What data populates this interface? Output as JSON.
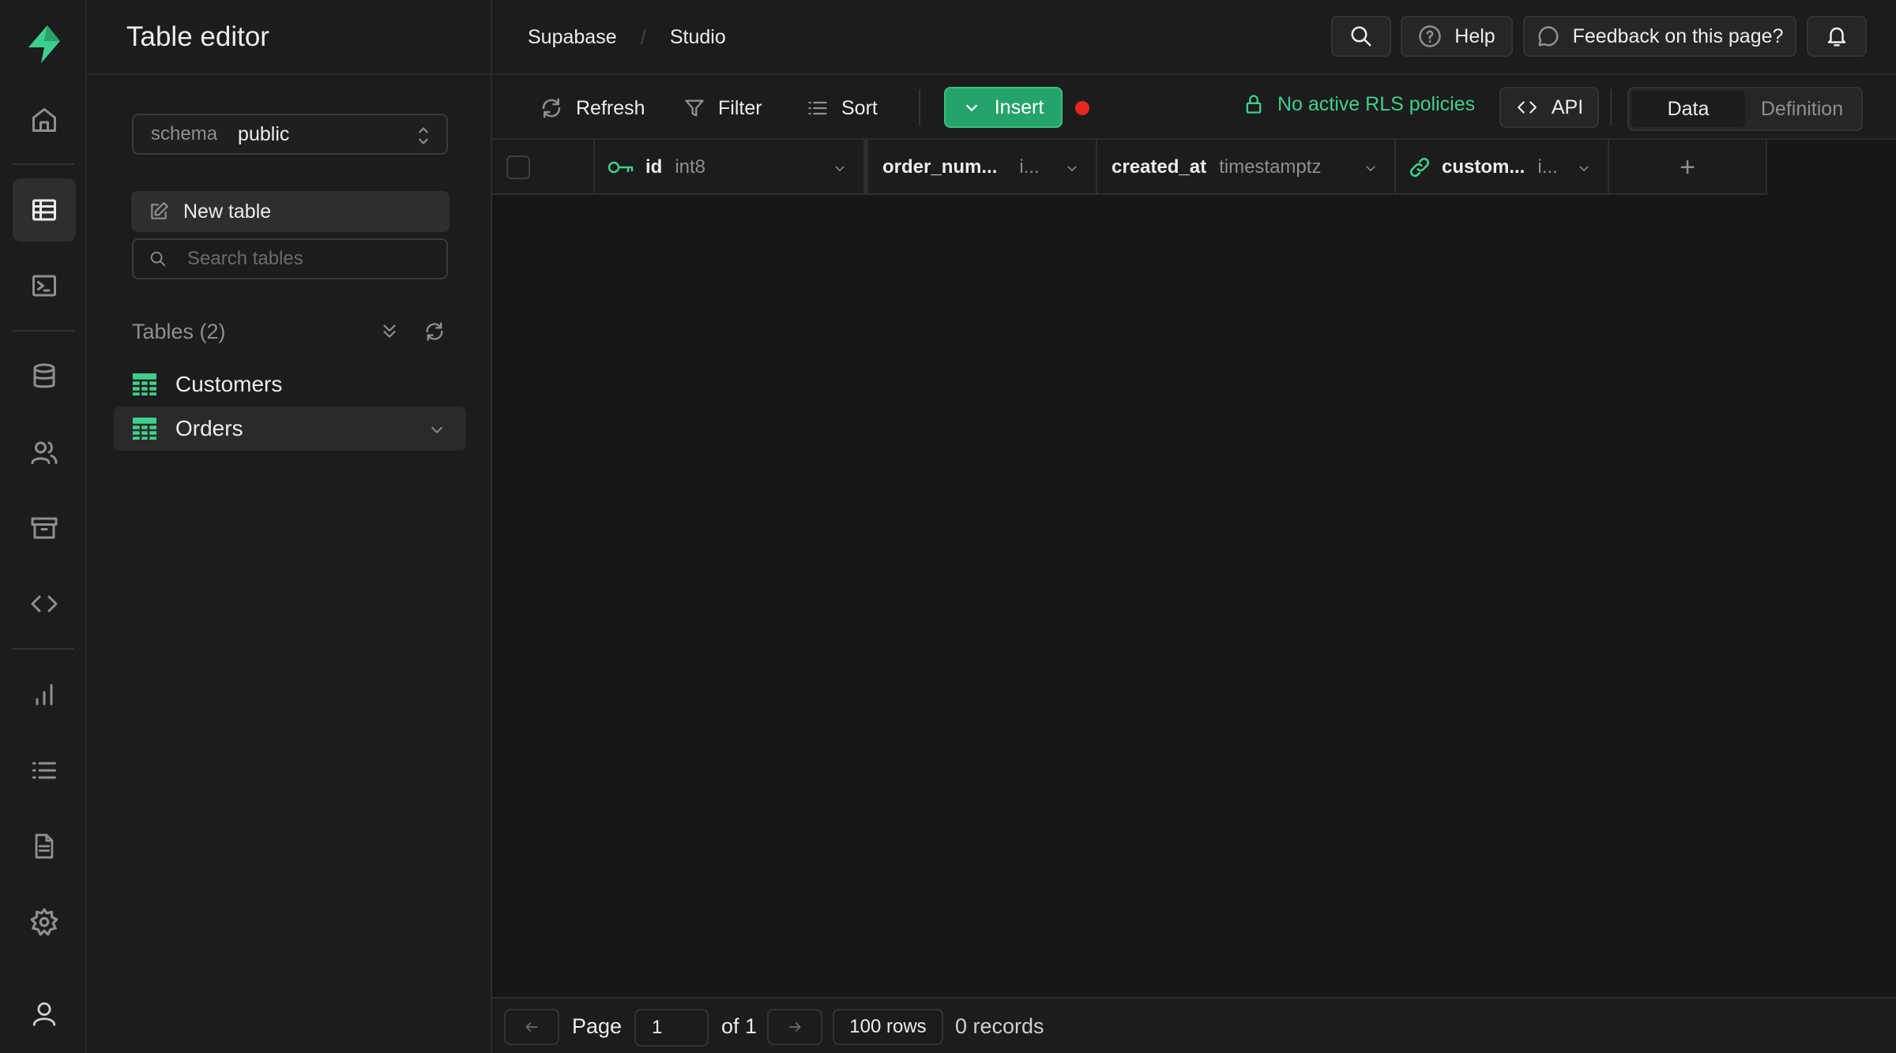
{
  "panel": {
    "title": "Table editor",
    "schema_label": "schema",
    "schema_value": "public",
    "new_table_label": "New table",
    "search_placeholder": "Search tables",
    "tables_heading": "Tables (2)",
    "tables": [
      {
        "name": "Customers",
        "active": false
      },
      {
        "name": "Orders",
        "active": true
      }
    ]
  },
  "breadcrumb": {
    "org": "Supabase",
    "project": "Studio"
  },
  "topbar": {
    "help_label": "Help",
    "feedback_label": "Feedback on this page?"
  },
  "toolbar": {
    "refresh_label": "Refresh",
    "filter_label": "Filter",
    "sort_label": "Sort",
    "insert_label": "Insert",
    "rls_label": "No active RLS policies",
    "api_label": "API",
    "view_tabs": [
      "Data",
      "Definition"
    ],
    "active_view": "Data"
  },
  "grid": {
    "columns": [
      {
        "name": "id",
        "type": "int8",
        "icon": "key-icon"
      },
      {
        "name": "order_num...",
        "type": "i...",
        "icon": ""
      },
      {
        "name": "created_at",
        "type": "timestamptz",
        "icon": ""
      },
      {
        "name": "custom...",
        "type": "i...",
        "icon": "link-icon"
      }
    ],
    "add_column_symbol": "+"
  },
  "footer": {
    "page_label": "Page",
    "page_value": "1",
    "of_label": "of 1",
    "rows_label": "100 rows",
    "records_label": "0 records"
  },
  "colors": {
    "brand": "#3ecf8e",
    "insert_bg": "#24a46a",
    "status_dot": "#e5271d",
    "background": "#161616",
    "surface": "#1c1c1c"
  }
}
